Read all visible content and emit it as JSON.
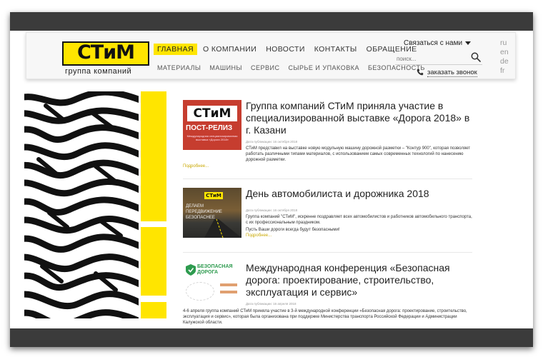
{
  "logo": {
    "text": "СТиМ",
    "subtitle": "группа компаний"
  },
  "nav": {
    "main": [
      {
        "label": "ГЛАВНАЯ",
        "active": true
      },
      {
        "label": "О КОМПАНИИ",
        "active": false
      },
      {
        "label": "НОВОСТИ",
        "active": false
      },
      {
        "label": "КОНТАКТЫ",
        "active": false
      },
      {
        "label": "ОБРАЩЕНИЕ",
        "active": false
      }
    ],
    "sub": [
      "МАТЕРИАЛЫ",
      "МАШИНЫ",
      "СЕРВИС",
      "СЫРЬЕ И УПАКОВКА",
      "БЕЗОПАСНОСТЬ"
    ]
  },
  "header": {
    "contact_label": "Связаться с нами",
    "search_placeholder": "поиск...",
    "call_label": "заказать звонок",
    "languages": [
      "ru",
      "en",
      "de",
      "fr"
    ]
  },
  "icons": {
    "search": "search-icon",
    "phone": "phone-icon",
    "caret": "caret-down-icon"
  },
  "colors": {
    "accent": "#ffe500",
    "frame": "#3b3b3b",
    "text": "#222222",
    "link": "#c9a800"
  },
  "news": [
    {
      "title": "Группа компаний СТиМ приняла участие в специализированной выставке «Дорога 2018» в г. Казани",
      "thumb_logo": "СТиМ",
      "thumb_label": "ПОСТ-РЕЛИЗ",
      "thumb_caption": "Международная специализированная выставка «Дорога 2018»",
      "meta": "Дата публикации: 16 октября 2018",
      "body": "СТиМ представил на выставке новую модульную машину дорожной разметки – \"Контур 900\", которая позволяет работать различными типами материалов, с использованием самых современных технологий по нанесению дорожной разметки.",
      "more": "Подробнее..."
    },
    {
      "title": "День автомобилиста и дорожника 2018",
      "thumb_logo": "СТиМ",
      "thumb_label": "ДЕЛАЕМ ПЕРЕДВИЖЕНИЕ БЕЗОПАСНЕЕ",
      "meta": "Дата публикации: 16 октября 2018",
      "body": "Группа компаний \"СТиМ\", искренне поздравляет всех автомобилистов и работников автомобильного транспорта, с их профессиональным праздником.",
      "body2": "Пусть Ваши дороги всегда будут безопасными!",
      "more": "Подробнее..."
    },
    {
      "title": "Международная конференция «Безопасная дорога: проектирование, строительство, эксплуатация и сервис»",
      "thumb_logo": "БЕЗОПАСНАЯ ДОРОГА",
      "meta": "Дата публикации: 16 апреля 2018",
      "body": "4-6 апреля группа компаний СТиМ приняла участие в 3-й международной конференции «Безопасная дорога: проектирование, строительство, эксплуатация и сервис», которая была организована при поддержке Министерства транспорта Российской Федерации и Администрации Калужской области."
    }
  ]
}
